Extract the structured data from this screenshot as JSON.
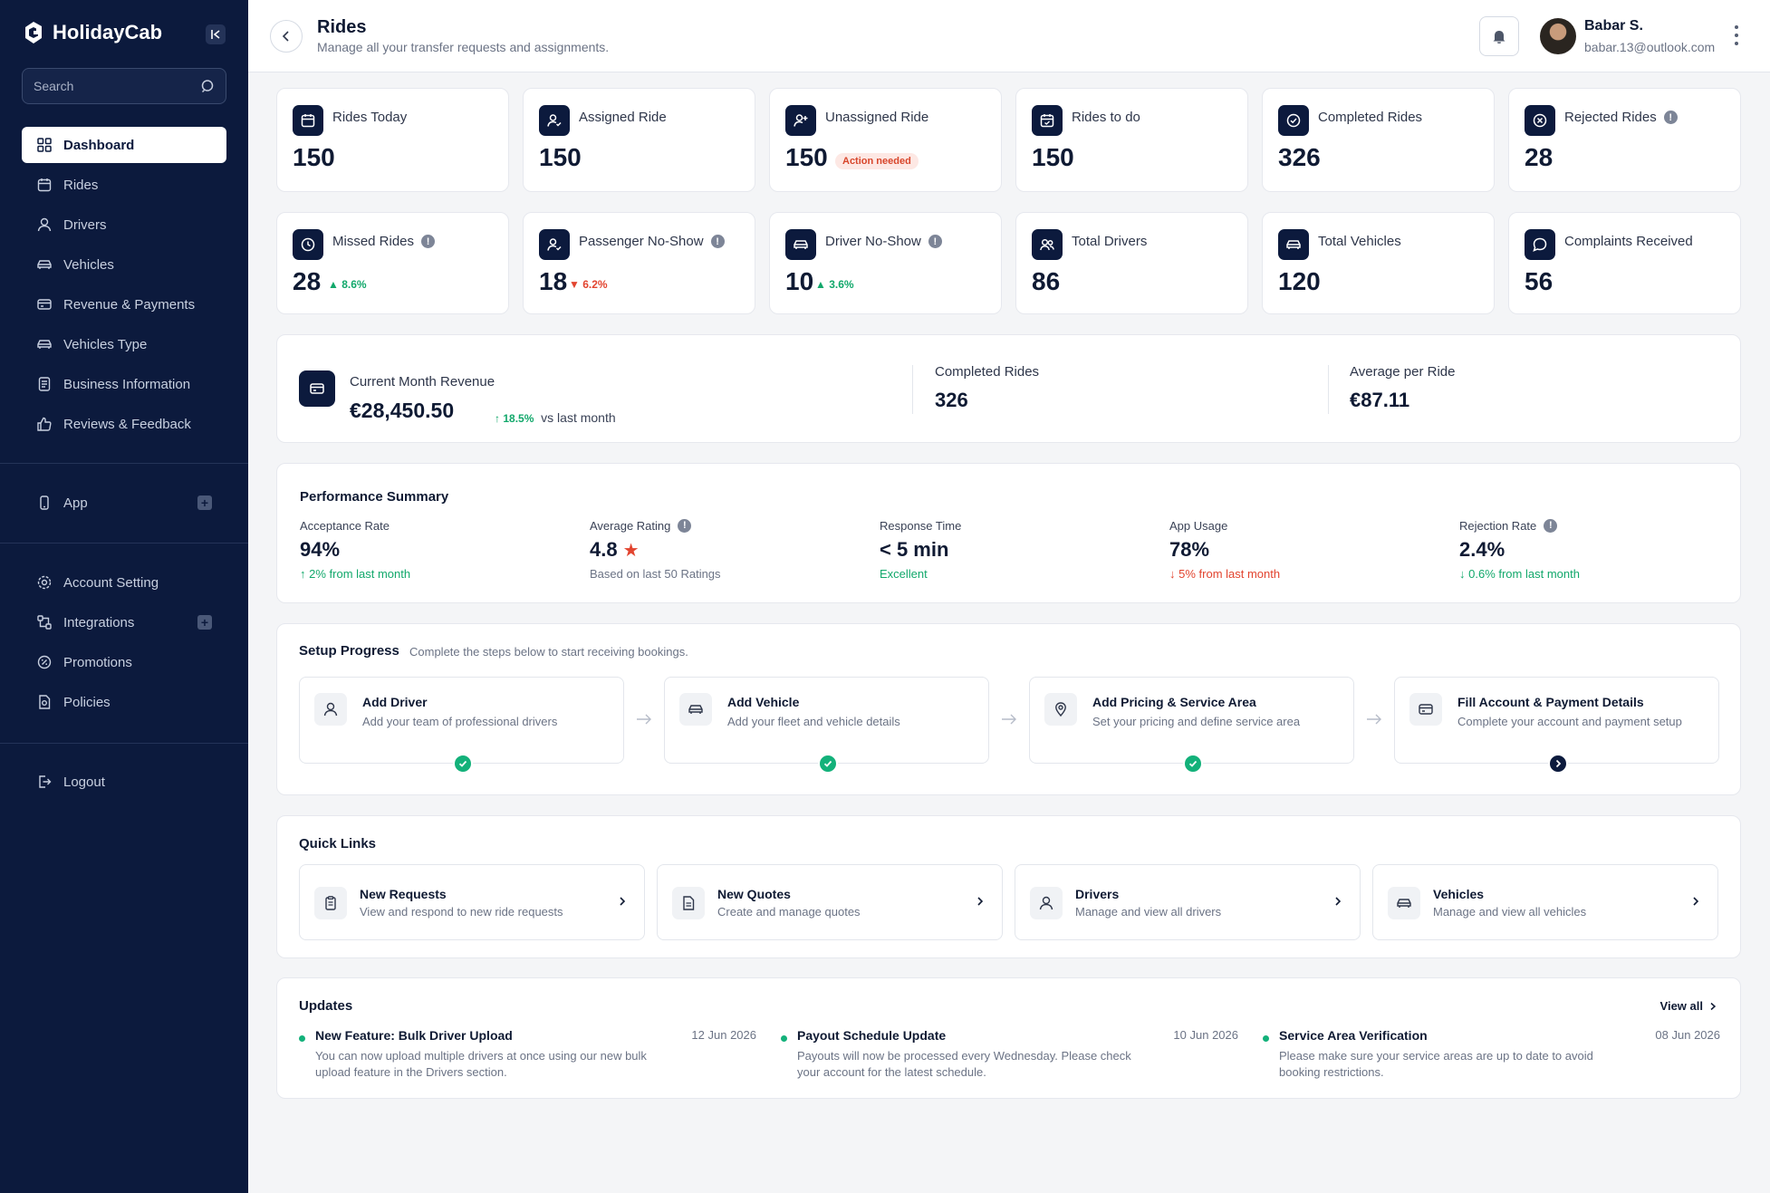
{
  "brand": {
    "name": "HolidayCab"
  },
  "sidebar": {
    "search_placeholder": "Search",
    "main_items": [
      {
        "label": "Dashboard",
        "icon": "grid-icon",
        "active": true
      },
      {
        "label": "Rides",
        "icon": "calendar-icon"
      },
      {
        "label": "Drivers",
        "icon": "user-icon"
      },
      {
        "label": "Vehicles",
        "icon": "car-icon"
      },
      {
        "label": "Revenue & Payments",
        "icon": "card-icon"
      },
      {
        "label": "Vehicles Type",
        "icon": "car-icon"
      },
      {
        "label": "Business Information",
        "icon": "document-icon"
      },
      {
        "label": "Reviews & Feedback",
        "icon": "thumbs-up-icon"
      }
    ],
    "app_item": {
      "label": "App",
      "icon": "phone-icon"
    },
    "settings_items": [
      {
        "label": "Account Setting",
        "icon": "gear-icon"
      },
      {
        "label": "Integrations",
        "icon": "integrations-icon"
      },
      {
        "label": "Promotions",
        "icon": "promo-icon"
      },
      {
        "label": "Policies",
        "icon": "policy-icon"
      }
    ],
    "logout": {
      "label": "Logout",
      "icon": "logout-icon"
    }
  },
  "header": {
    "title": "Rides",
    "subtitle": "Manage all your transfer requests and assignments.",
    "user_name": "Babar S.",
    "user_email": "babar.13@outlook.com"
  },
  "stats_row1": [
    {
      "label": "Rides Today",
      "value": "150",
      "icon": "calendar-icon"
    },
    {
      "label": "Assigned Ride",
      "value": "150",
      "icon": "user-check-icon"
    },
    {
      "label": "Unassigned Ride",
      "value": "150",
      "icon": "user-plus-icon",
      "badge": "Action needed"
    },
    {
      "label": "Rides to do",
      "value": "150",
      "icon": "calendar-check-icon"
    },
    {
      "label": "Completed Rides",
      "value": "326",
      "icon": "check-circle-icon"
    },
    {
      "label": "Rejected Rides",
      "value": "28",
      "icon": "x-circle-icon",
      "info": true
    }
  ],
  "stats_row2": [
    {
      "label": "Missed Rides",
      "value": "28",
      "icon": "clock-icon",
      "info": true,
      "trend": "8.6%",
      "trend_dir": "up"
    },
    {
      "label": "Passenger No-Show",
      "value": "18",
      "icon": "user-check-icon",
      "info": true,
      "trend": "6.2%",
      "trend_dir": "down"
    },
    {
      "label": "Driver No-Show",
      "value": "10",
      "icon": "car-icon",
      "info": true,
      "trend": "3.6%",
      "trend_dir": "up"
    },
    {
      "label": "Total Drivers",
      "value": "86",
      "icon": "users-icon"
    },
    {
      "label": "Total Vehicles",
      "value": "120",
      "icon": "car-icon"
    },
    {
      "label": "Complaints Received",
      "value": "56",
      "icon": "chat-icon"
    }
  ],
  "revenue": {
    "label": "Current Month Revenue",
    "value": "€28,450.50",
    "trend": "18.5%",
    "trend_suffix": "vs last month",
    "completed_label": "Completed Rides",
    "completed_value": "326",
    "avg_label": "Average per Ride",
    "avg_value": "€87.11"
  },
  "performance": {
    "title": "Performance Summary",
    "metrics": [
      {
        "label": "Acceptance Rate",
        "value": "94%",
        "note": "2% from last month",
        "note_kind": "up"
      },
      {
        "label": "Average Rating",
        "value": "4.8",
        "star": "★",
        "info": true,
        "note": "Based on  last 50 Ratings",
        "note_kind": "grey"
      },
      {
        "label": "Response Time",
        "value": "< 5 min",
        "note": "Excellent",
        "note_kind": "good"
      },
      {
        "label": "App Usage",
        "value": "78%",
        "note": "5% from last month",
        "note_kind": "down"
      },
      {
        "label": "Rejection Rate",
        "value": "2.4%",
        "info": true,
        "note": "0.6% from last month",
        "note_kind": "good-down"
      }
    ]
  },
  "setup": {
    "title": "Setup Progress",
    "subtitle": "Complete the steps below to start receiving bookings.",
    "steps": [
      {
        "title": "Add Driver",
        "desc": "Add your team of professional drivers",
        "icon": "user-icon",
        "status": "done"
      },
      {
        "title": "Add Vehicle",
        "desc": "Add your fleet and vehicle details",
        "icon": "car-icon",
        "status": "done"
      },
      {
        "title": "Add Pricing & Service Area",
        "desc": "Set your pricing and define service area",
        "icon": "location-pin-icon",
        "status": "done"
      },
      {
        "title": "Fill Account & Payment Details",
        "desc": "Complete your account and payment setup",
        "icon": "card-icon",
        "status": "next"
      }
    ]
  },
  "quick_links": {
    "title": "Quick Links",
    "items": [
      {
        "title": "New Requests",
        "desc": "View and respond to new ride requests",
        "icon": "clipboard-icon"
      },
      {
        "title": "New Quotes",
        "desc": "Create and manage quotes",
        "icon": "document-icon"
      },
      {
        "title": "Drivers",
        "desc": "Manage and view all drivers",
        "icon": "user-icon"
      },
      {
        "title": "Vehicles",
        "desc": "Manage and view all vehicles",
        "icon": "car-icon"
      }
    ]
  },
  "updates": {
    "title": "Updates",
    "view_all": "View all",
    "items": [
      {
        "title": "New Feature: Bulk Driver Upload",
        "date": "12 Jun 2026",
        "text": "You can now upload multiple drivers at once using our new bulk upload feature in the Drivers section."
      },
      {
        "title": "Payout Schedule Update",
        "date": "10 Jun 2026",
        "text": "Payouts will now be processed every Wednesday. Please check your account for the latest schedule."
      },
      {
        "title": "Service Area Verification",
        "date": "08 Jun 2026",
        "text": "Please make sure your service areas are up to date to avoid booking restrictions."
      }
    ]
  },
  "colors": {
    "navy": "#0c1a3d",
    "green": "#12a86b",
    "red": "#e2442f",
    "star": "#e2442f"
  }
}
